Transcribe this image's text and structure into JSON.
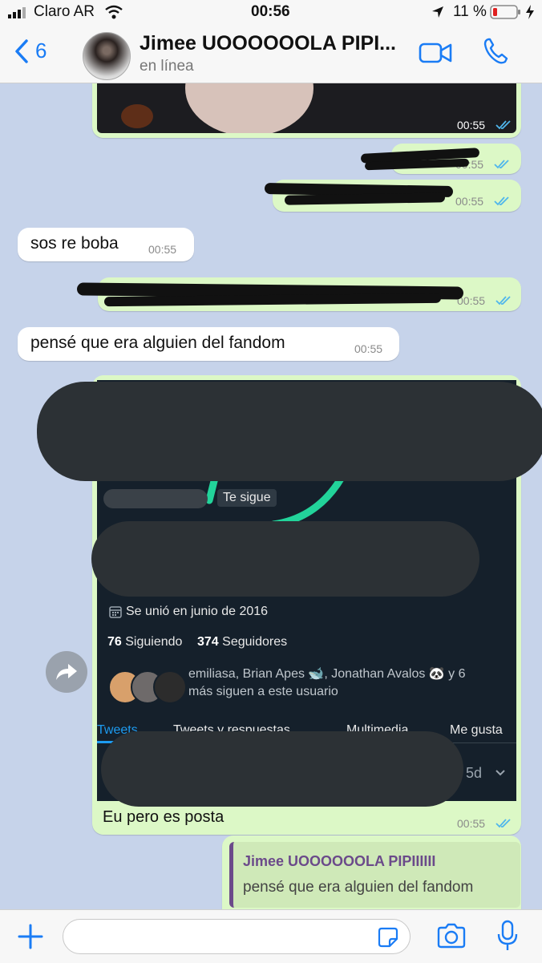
{
  "status_bar": {
    "carrier": "Claro AR",
    "time": "00:56",
    "battery": "11 %"
  },
  "header": {
    "back_count": "6",
    "contact_name": "Jimee UOOOOOOLA PIPI...",
    "status": "en línea"
  },
  "messages": [
    {
      "time": "00:55"
    },
    {
      "time": "00:55"
    },
    {
      "time": "00:55"
    },
    {
      "text": "sos re boba",
      "time": "00:55"
    },
    {
      "time": "00:55"
    },
    {
      "text": "pensé que era alguien del fandom",
      "time": "00:55"
    },
    {
      "caption": "Eu pero es posta",
      "time": "00:55"
    }
  ],
  "tweet_screenshot": {
    "follows_you": "Te sigue",
    "joined": "Se unió en junio de 2016",
    "following_count": "76",
    "following_label": "Siguiendo",
    "followers_count": "374",
    "followers_label": "Seguidores",
    "followed_by_line1": "emiliasa, Brian Apes 🐋, Jonathan Avalos 🐼 y 6",
    "followed_by_line2": "más siguen a este usuario",
    "tabs": [
      "Tweets",
      "Tweets y respuestas",
      "Multimedia",
      "Me gusta"
    ],
    "age": "5d"
  },
  "reply_quote": {
    "author": "Jimee UOOOOOOLA PIPIIIIII",
    "text": "pensé que era alguien del fandom"
  },
  "colors": {
    "accent": "#1a7cf5",
    "outgoing": "#dcf8c6",
    "incoming": "#ffffff",
    "chat_bg": "#c6d3ea"
  }
}
